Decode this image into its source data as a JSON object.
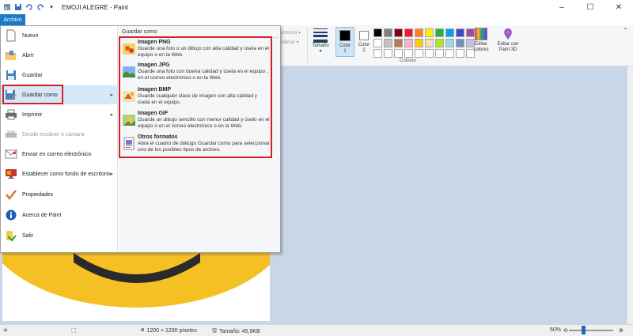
{
  "window": {
    "title": "EMOJI ALEGRE - Paint",
    "controls": [
      "minimize",
      "maximize",
      "close"
    ]
  },
  "quick_access": {
    "icons": [
      "paint-app-icon",
      "save-icon",
      "undo-icon",
      "redo-icon",
      "customize-qat-icon"
    ]
  },
  "ribbon": {
    "file_tab": "Archivo",
    "contorno_label": "ontorno",
    "rellenar_label": "ellenar",
    "tamano_label": "Tamaño",
    "color1_label": "Color\n1",
    "color2_label": "Color\n2",
    "colores_label": "Colores",
    "editar_colores_label": "Editar\ncolores",
    "paint3d_label": "Editar con\nPaint 3D",
    "color1_value": "#000000",
    "color2_value": "#ffffff",
    "palette": [
      "#000000",
      "#7f7f7f",
      "#880015",
      "#ed1c24",
      "#ff7f27",
      "#fff200",
      "#22b14c",
      "#00a2e8",
      "#3f48cc",
      "#a349a4",
      "#ffffff",
      "#c3c3c3",
      "#b97a57",
      "#ffaec9",
      "#ffc90e",
      "#efe4b0",
      "#b5e61d",
      "#99d9ea",
      "#7092be",
      "#c8bfe7",
      "#ffffff",
      "#ffffff",
      "#ffffff",
      "#ffffff",
      "#ffffff",
      "#ffffff",
      "#ffffff",
      "#ffffff",
      "#ffffff",
      "#ffffff"
    ]
  },
  "file_menu": {
    "items": [
      {
        "label": "Nuevo",
        "icon": "new-file-icon",
        "enabled": true,
        "has_submenu": false
      },
      {
        "label": "Abrir",
        "icon": "open-folder-icon",
        "enabled": true,
        "has_submenu": false
      },
      {
        "label": "Guardar",
        "icon": "save-icon",
        "enabled": true,
        "has_submenu": false
      },
      {
        "label": "Guardar como",
        "icon": "save-as-icon",
        "enabled": true,
        "has_submenu": true
      },
      {
        "label": "Imprimir",
        "icon": "printer-icon",
        "enabled": true,
        "has_submenu": true
      },
      {
        "label": "Desde escáner o cámara",
        "icon": "scanner-icon",
        "enabled": false,
        "has_submenu": false
      },
      {
        "label": "Enviar en correo electrónico",
        "icon": "email-icon",
        "enabled": true,
        "has_submenu": false
      },
      {
        "label": "Establecer como fondo de escritorio",
        "icon": "desktop-background-icon",
        "enabled": true,
        "has_submenu": true
      },
      {
        "label": "Propiedades",
        "icon": "checkmark-icon",
        "enabled": true,
        "has_submenu": false
      },
      {
        "label": "Acerca de Paint",
        "icon": "info-icon",
        "enabled": true,
        "has_submenu": false
      },
      {
        "label": "Salir",
        "icon": "exit-icon",
        "enabled": true,
        "has_submenu": false
      }
    ]
  },
  "save_as_submenu": {
    "title": "Guardar como",
    "items": [
      {
        "name": "Imagen PNG",
        "desc": "Guarde una foto o un dibujo con alta calidad y úsela en el equipo o en la Web.",
        "icon": "png-image-icon"
      },
      {
        "name": "Imagen JPG",
        "desc": "Guarde una foto con buena calidad y úsela en el equipo , en el correo electrónico o en la Web.",
        "icon": "jpg-image-icon"
      },
      {
        "name": "Imagen BMP",
        "desc": "Guarde cualquier clase de imagen con alta calidad y úsela en el equipo.",
        "icon": "bmp-image-icon"
      },
      {
        "name": "Imagen GIF",
        "desc": "Guarde un dibujo sencillo con menor calidad y úselo en el equipo o en el correo electrónico o en la Web.",
        "icon": "gif-image-icon"
      },
      {
        "name": "Otros formatos",
        "desc": "Abra el cuadro de diálogo Guardar como para seleccionar uno de los posibles tipos de archivo.",
        "icon": "other-formats-icon"
      }
    ]
  },
  "statusbar": {
    "dimensions": "1200 × 1200 píxeles",
    "size": "Tamaño: 45,9KB",
    "zoom": "50%",
    "zoom_level": 0.5
  }
}
